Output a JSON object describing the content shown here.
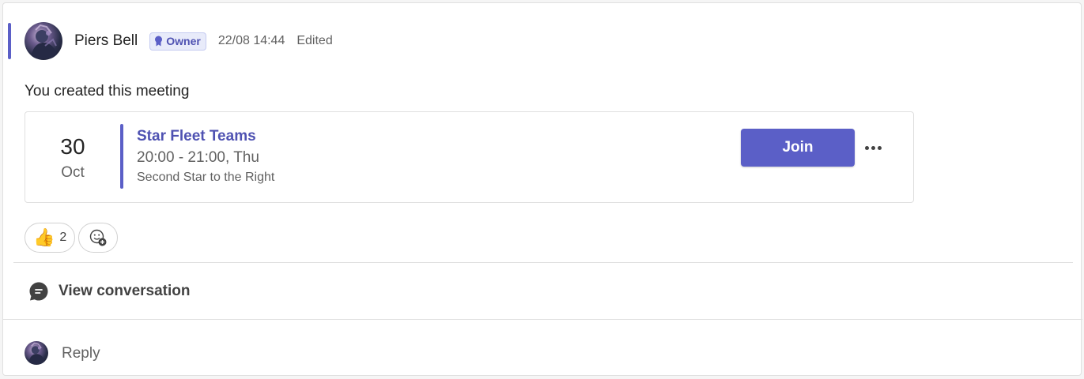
{
  "theme": {
    "accent": "#5b5fc7",
    "accent_text": "#4f52b2"
  },
  "post": {
    "author": "Piers Bell",
    "role_badge": "Owner",
    "timestamp": "22/08 14:44",
    "edited_label": "Edited",
    "message": "You created this meeting"
  },
  "meeting": {
    "day": "30",
    "month": "Oct",
    "title": "Star Fleet Teams",
    "time": "20:00 - 21:00, Thu",
    "location": "Second Star to the Right",
    "join_label": "Join"
  },
  "reactions": [
    {
      "emoji": "👍",
      "icon": "thumbs-up-icon",
      "count": "2"
    }
  ],
  "add_reaction_icon": "emoji-add-icon",
  "view_conversation": {
    "label": "View conversation",
    "icon": "chat-bubble-icon"
  },
  "reply": {
    "label": "Reply"
  }
}
